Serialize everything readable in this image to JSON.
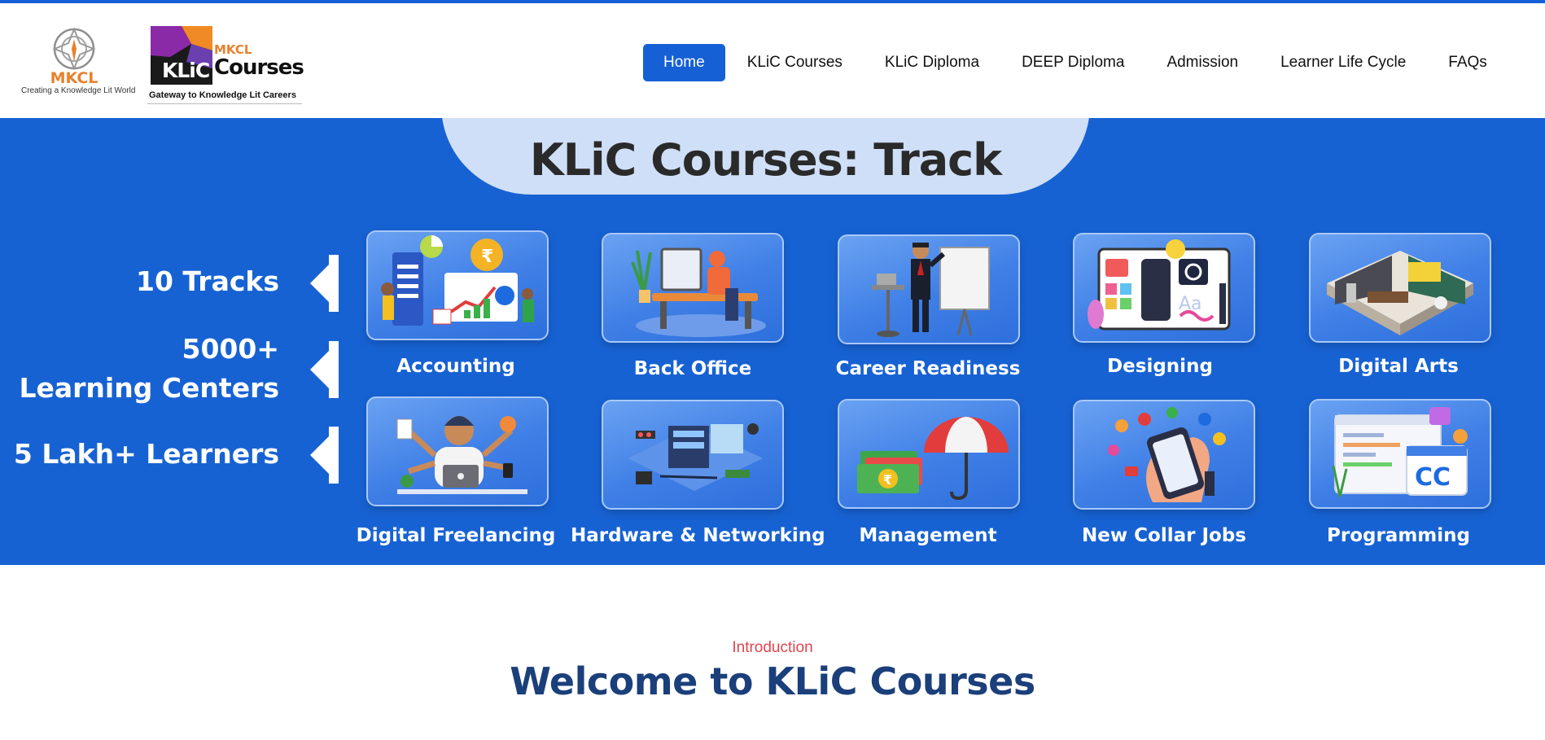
{
  "header": {
    "mkcl_logo": {
      "name": "MKCL",
      "tagline": "Creating a Knowledge Lit World"
    },
    "klic_logo": {
      "mkcl": "MKCL",
      "klic": "KLiC",
      "courses": "Courses",
      "tagline": "Gateway to Knowledge Lit Careers"
    },
    "nav": [
      {
        "label": "Home",
        "active": true
      },
      {
        "label": "KLiC Courses",
        "active": false
      },
      {
        "label": "KLiC Diploma",
        "active": false
      },
      {
        "label": "DEEP Diploma",
        "active": false
      },
      {
        "label": "Admission",
        "active": false
      },
      {
        "label": "Learner Life Cycle",
        "active": false
      },
      {
        "label": "FAQs",
        "active": false
      }
    ]
  },
  "banner": {
    "title": "KLiC Courses: Track",
    "stats": [
      {
        "line1": "10 Tracks",
        "line2": ""
      },
      {
        "line1": "5000+",
        "line2": "Learning Centers"
      },
      {
        "line1": "5 Lakh+ Learners",
        "line2": ""
      }
    ],
    "tracks": [
      {
        "label": "Accounting",
        "icon": "accounting-icon"
      },
      {
        "label": "Back Office",
        "icon": "back-office-icon"
      },
      {
        "label": "Career Readiness",
        "icon": "career-readiness-icon"
      },
      {
        "label": "Designing",
        "icon": "designing-icon"
      },
      {
        "label": "Digital Arts",
        "icon": "digital-arts-icon"
      },
      {
        "label": "Digital Freelancing",
        "icon": "digital-freelancing-icon"
      },
      {
        "label": "Hardware & Networking",
        "icon": "hardware-networking-icon"
      },
      {
        "label": "Management",
        "icon": "management-icon"
      },
      {
        "label": "New Collar Jobs",
        "icon": "new-collar-jobs-icon"
      },
      {
        "label": "Programming",
        "icon": "programming-icon"
      }
    ]
  },
  "intro": {
    "eyebrow": "Introduction",
    "heading": "Welcome to KLiC Courses"
  },
  "colors": {
    "primary_blue": "#1560d4",
    "banner_blue": "#1762d3",
    "accent_orange": "#e8812e",
    "intro_red": "#e0454f",
    "heading_navy": "#1b3f7a"
  }
}
